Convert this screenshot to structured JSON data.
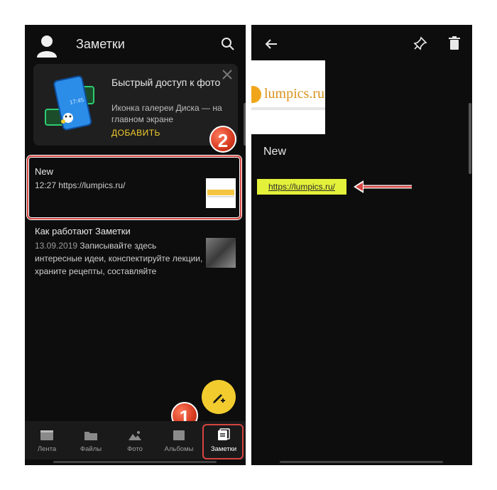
{
  "left": {
    "title": "Заметки",
    "promo": {
      "title": "Быстрый доступ к фото",
      "description": "Иконка галереи Диска — на главном экране",
      "action": "ДОБАВИТЬ",
      "phone_time": "17:45"
    },
    "notes": [
      {
        "title": "New",
        "time": "12:27",
        "text": "https://lumpics.ru/"
      },
      {
        "title": "Как работают Заметки",
        "date": "13.09.2019",
        "text": "Записывайте здесь интересные идеи, конспектируйте лекции, храните рецепты, составляйте"
      }
    ],
    "nav": [
      {
        "label": "Лента",
        "icon": "feed-icon"
      },
      {
        "label": "Файлы",
        "icon": "folder-icon"
      },
      {
        "label": "Фото",
        "icon": "photo-icon"
      },
      {
        "label": "Альбомы",
        "icon": "album-icon"
      },
      {
        "label": "Заметки",
        "icon": "notes-icon",
        "active": true
      }
    ]
  },
  "right": {
    "note_title": "New",
    "link": "https://lumpics.ru/",
    "image_text": "lumpics.ru"
  },
  "annotations": {
    "badge_1": "1",
    "badge_2": "2"
  },
  "colors": {
    "background": "#0d0d0d",
    "accent": "#f2cc2e",
    "highlight": "#d64541",
    "link_highlight": "#e4f13a"
  }
}
